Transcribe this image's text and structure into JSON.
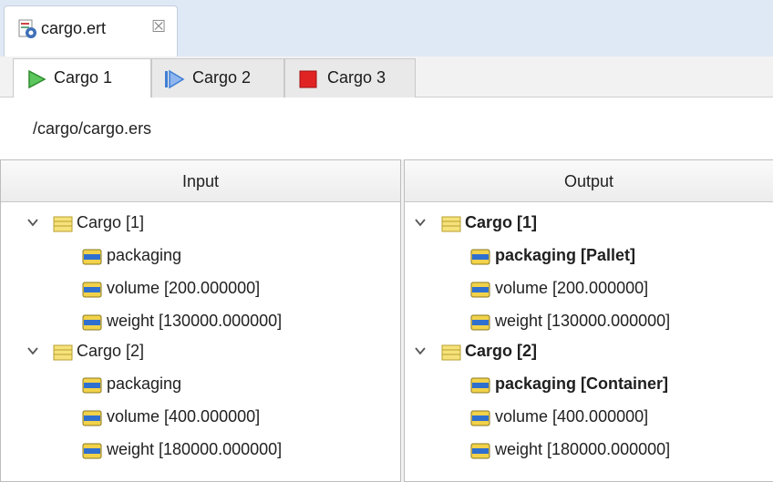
{
  "editor": {
    "file_tab_label": "cargo.ert",
    "close_glyph": "☒"
  },
  "cargo_tabs": [
    {
      "label": "Cargo 1",
      "icon": "run-icon",
      "icon_color": "#3aa83a",
      "active": true
    },
    {
      "label": "Cargo 2",
      "icon": "step-forward-icon",
      "icon_color": "#3f7fd6",
      "active": false
    },
    {
      "label": "Cargo 3",
      "icon": "stop-icon",
      "icon_color": "#e02424",
      "active": false
    }
  ],
  "path": "/cargo/cargo.ers",
  "input_panel": {
    "header": "Input",
    "groups": [
      {
        "label": "Cargo [1]",
        "children": [
          "packaging",
          "volume [200.000000]",
          "weight [130000.000000]"
        ]
      },
      {
        "label": "Cargo [2]",
        "children": [
          "packaging",
          "volume [400.000000]",
          "weight [180000.000000]"
        ]
      }
    ]
  },
  "output_panel": {
    "header": "Output",
    "groups": [
      {
        "label": "Cargo [1]",
        "children": [
          "packaging [Pallet]",
          "volume [200.000000]",
          "weight [130000.000000]"
        ]
      },
      {
        "label": "Cargo [2]",
        "children": [
          "packaging [Container]",
          "volume [400.000000]",
          "weight [180000.000000]"
        ]
      }
    ]
  },
  "colors": {
    "group_icon_fill": "#f6e27a",
    "group_icon_stroke": "#b8a030",
    "attr_icon_blue": "#2f6fd0",
    "attr_icon_yellow": "#f2d24a",
    "tab_bar_bg": "#dfe8f5"
  }
}
